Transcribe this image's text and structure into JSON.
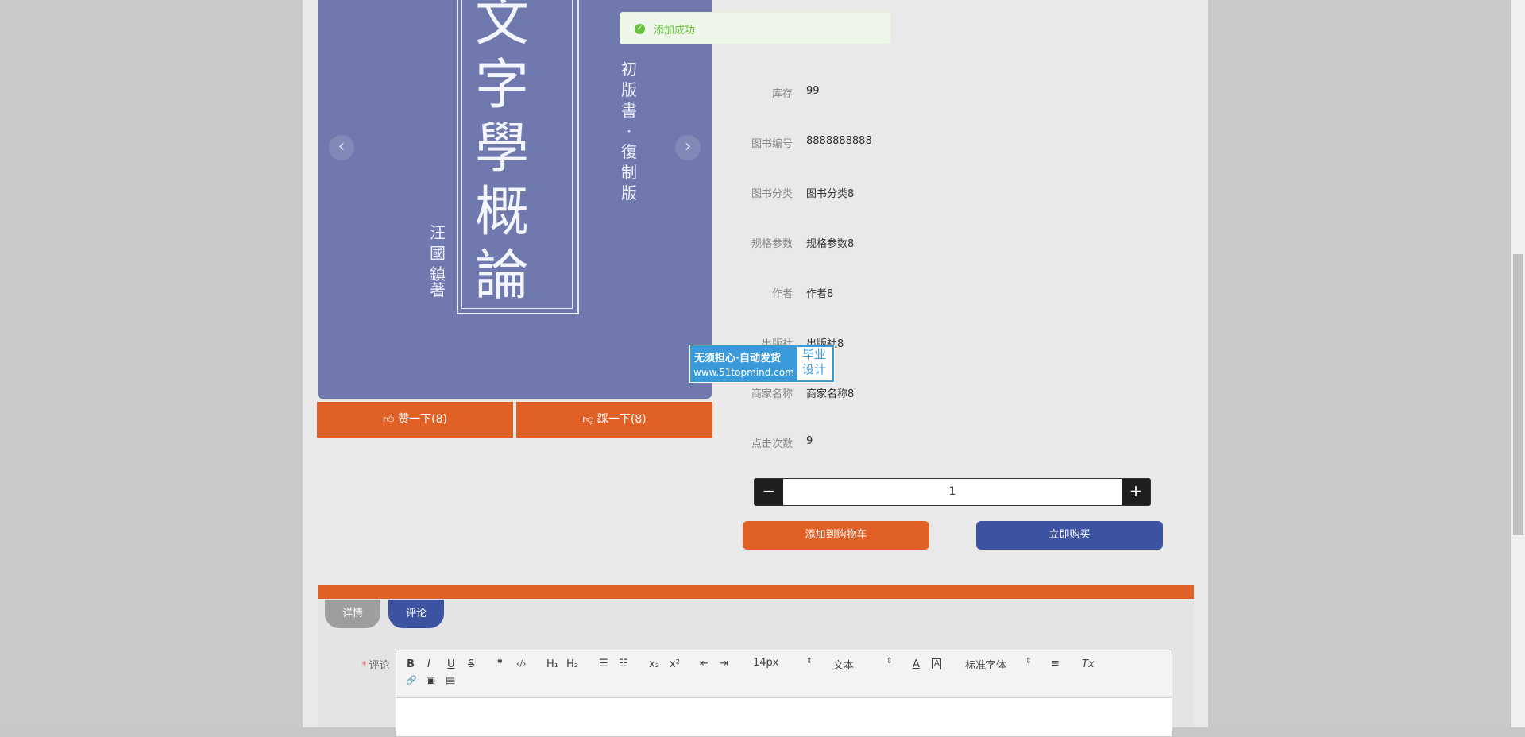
{
  "toast": {
    "message": "添加成功"
  },
  "cover": {
    "title_chars": [
      "文",
      "字",
      "學",
      "概",
      "論"
    ],
    "edition": "初版書·復制版",
    "author": "汪國鎮",
    "author_suffix": "著"
  },
  "carousel": {
    "prev": "‹",
    "next": "›"
  },
  "votes": {
    "like_label": "赞一下(8)",
    "dislike_label": "踩一下(8)"
  },
  "info": [
    {
      "label": "库存",
      "value": "99"
    },
    {
      "label": "图书编号",
      "value": "8888888888"
    },
    {
      "label": "图书分类",
      "value": "图书分类8"
    },
    {
      "label": "规格参数",
      "value": "规格参数8"
    },
    {
      "label": "作者",
      "value": "作者8"
    },
    {
      "label": "出版社",
      "value": "出版社8"
    },
    {
      "label": "商家名称",
      "value": "商家名称8"
    },
    {
      "label": "点击次数",
      "value": "9"
    }
  ],
  "quantity": {
    "minus": "−",
    "value": "1",
    "plus": "+"
  },
  "actions": {
    "add_to_cart": "添加到购物车",
    "buy_now": "立即购买"
  },
  "watermark": {
    "line1": "无须担心·自动发货",
    "line2": "www.51topmind.com",
    "tag": "毕业设计"
  },
  "tabs": [
    {
      "label": "详情"
    },
    {
      "label": "评论"
    }
  ],
  "comment_form": {
    "label": "评论",
    "required_mark": "*",
    "toolbar": {
      "bold": "B",
      "italic": "I",
      "underline": "U",
      "strike": "S",
      "blockquote": "❞",
      "code": "‹/›",
      "h1": "H₁",
      "h2": "H₂",
      "ordered_list": "☰",
      "bullet_list": "☷",
      "subscript": "x₂",
      "superscript": "x²",
      "outdent": "⇤",
      "indent": "⇥",
      "size": "14px",
      "header": "文本",
      "color": "A",
      "background": "A",
      "font": "标准字体",
      "align": "≡",
      "clean": "Tx",
      "link": "🔗",
      "image": "▣",
      "video": "▤"
    }
  },
  "colors": {
    "accent_orange": "#e06026",
    "accent_blue": "#3b53a0",
    "success_green": "#67c23a"
  }
}
